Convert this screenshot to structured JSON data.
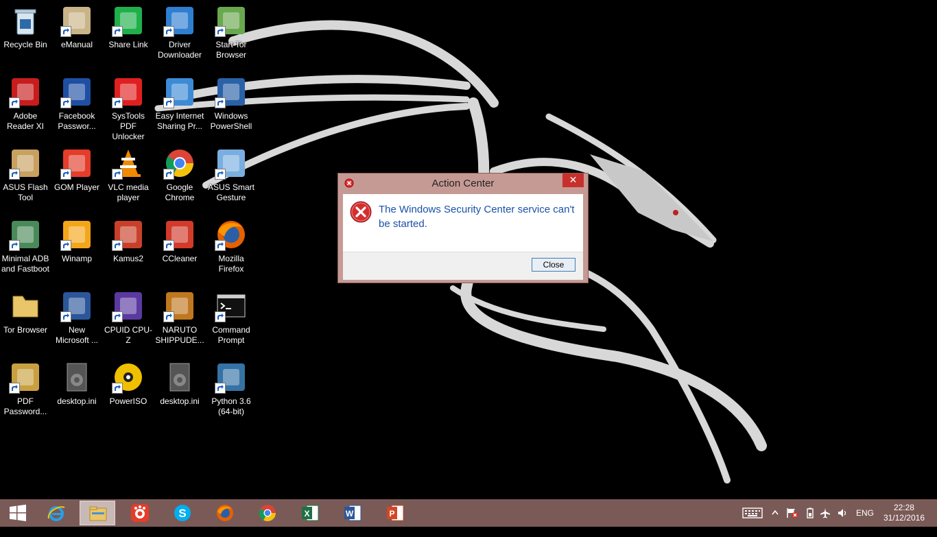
{
  "desktop": {
    "icons": [
      {
        "label": "Recycle Bin",
        "icon": "recycle-bin-icon"
      },
      {
        "label": "eManual",
        "icon": "emanual-icon"
      },
      {
        "label": "Share Link",
        "icon": "share-link-icon"
      },
      {
        "label": "Driver Downloader",
        "icon": "driver-downloader-icon"
      },
      {
        "label": "Start Tor Browser",
        "icon": "tor-browser-icon"
      },
      {
        "label": "Adobe Reader XI",
        "icon": "adobe-reader-icon"
      },
      {
        "label": "Facebook Passwor...",
        "icon": "facebook-password-icon"
      },
      {
        "label": "SysTools PDF Unlocker",
        "icon": "systools-pdf-unlocker-icon"
      },
      {
        "label": "Easy Internet Sharing Pr...",
        "icon": "easy-internet-sharing-icon"
      },
      {
        "label": "Windows PowerShell",
        "icon": "powershell-icon"
      },
      {
        "label": "ASUS Flash Tool",
        "icon": "asus-flash-tool-icon"
      },
      {
        "label": "GOM Player",
        "icon": "gom-player-icon"
      },
      {
        "label": "VLC media player",
        "icon": "vlc-icon"
      },
      {
        "label": "Google Chrome",
        "icon": "chrome-icon"
      },
      {
        "label": "ASUS Smart Gesture",
        "icon": "asus-smart-gesture-icon"
      },
      {
        "label": "Minimal ADB and Fastboot",
        "icon": "minimal-adb-icon"
      },
      {
        "label": "Winamp",
        "icon": "winamp-icon"
      },
      {
        "label": "Kamus2",
        "icon": "kamus2-icon"
      },
      {
        "label": "CCleaner",
        "icon": "ccleaner-icon"
      },
      {
        "label": "Mozilla Firefox",
        "icon": "firefox-icon"
      },
      {
        "label": "Tor Browser",
        "icon": "folder-icon"
      },
      {
        "label": "New Microsoft ...",
        "icon": "word-document-icon"
      },
      {
        "label": "CPUID CPU-Z",
        "icon": "cpuz-icon"
      },
      {
        "label": "NARUTO SHIPPUDE...",
        "icon": "naruto-icon"
      },
      {
        "label": "Command Prompt",
        "icon": "command-prompt-icon"
      },
      {
        "label": "PDF Password...",
        "icon": "pdf-password-icon"
      },
      {
        "label": "desktop.ini",
        "icon": "settings-file-icon"
      },
      {
        "label": "PowerISO",
        "icon": "poweriso-icon"
      },
      {
        "label": "desktop.ini",
        "icon": "settings-file-icon"
      },
      {
        "label": "Python 3.6 (64-bit)",
        "icon": "python-icon"
      }
    ]
  },
  "dialog": {
    "title": "Action Center",
    "message": "The Windows Security Center service can't be started.",
    "close_button": "Close",
    "close_x": "✕"
  },
  "taskbar": {
    "apps": [
      "start-icon",
      "internet-explorer-icon",
      "file-explorer-icon",
      "gom-player-icon",
      "skype-icon",
      "firefox-icon",
      "chrome-icon",
      "excel-icon",
      "word-icon",
      "powerpoint-icon"
    ],
    "language": "ENG",
    "time": "22:28",
    "date": "31/12/2016"
  },
  "colors": {
    "taskbar": "#7a5a57",
    "dialog_frame": "#c69a94",
    "dialog_close": "#c7302b",
    "message_text": "#1a50a8"
  }
}
